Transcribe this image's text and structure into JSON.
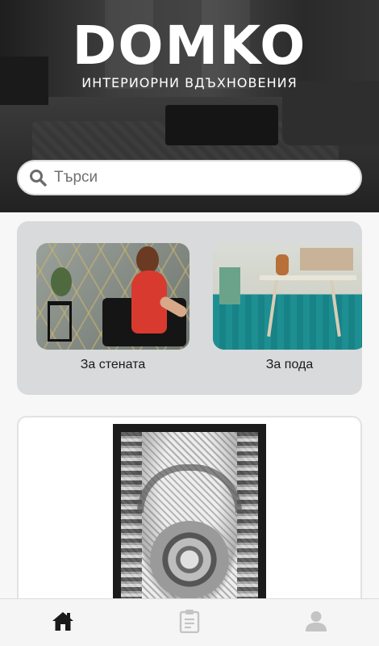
{
  "header": {
    "brand": "DOMKO",
    "tagline": "ИНТЕРИОРНИ ВДЪХНОВЕНИЯ"
  },
  "search": {
    "placeholder": "Търси",
    "value": "",
    "icon": "search-icon"
  },
  "categories": [
    {
      "label": "За стената",
      "image": "wallpaper-photo"
    },
    {
      "label": "За пода",
      "image": "floor-carpet-photo"
    }
  ],
  "featured_product": {
    "image": "ornamental-rug-photo"
  },
  "bottom_nav": {
    "items": [
      {
        "icon": "home-icon",
        "active": true
      },
      {
        "icon": "clipboard-icon",
        "active": false
      },
      {
        "icon": "user-icon",
        "active": false
      }
    ],
    "active_color": "#1a1a1a",
    "inactive_color": "#c4c4c4"
  },
  "colors": {
    "panel_bg": "#d8dadb",
    "page_bg": "#f7f7f7"
  }
}
